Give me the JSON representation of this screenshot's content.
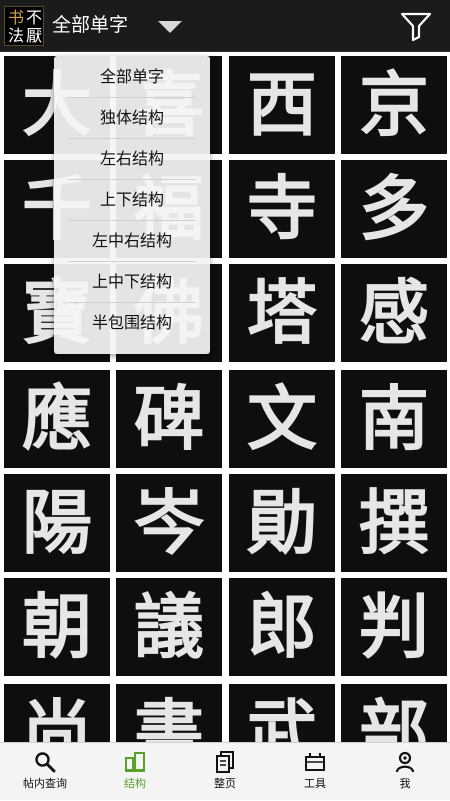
{
  "header": {
    "logo_chars": [
      "书",
      "不",
      "法",
      "厭"
    ],
    "title": "全部单字"
  },
  "characters": [
    "大",
    "喜",
    "西",
    "京",
    "千",
    "福",
    "寺",
    "多",
    "寶",
    "佛",
    "塔",
    "感",
    "應",
    "碑",
    "文",
    "南",
    "陽",
    "岑",
    "勛",
    "撰",
    "朝",
    "議",
    "郎",
    "判",
    "尚",
    "書",
    "武",
    "部"
  ],
  "menu": {
    "items": [
      "全部单字",
      "独体结构",
      "左右结构",
      "上下结构",
      "左中右结构",
      "上中下结构",
      "半包围结构"
    ]
  },
  "bottom_nav": {
    "items": [
      {
        "label": "帖内查询",
        "icon": "search-icon"
      },
      {
        "label": "结构",
        "icon": "structure-icon"
      },
      {
        "label": "整页",
        "icon": "page-icon"
      },
      {
        "label": "工具",
        "icon": "toolbox-icon"
      },
      {
        "label": "我",
        "icon": "user-icon"
      }
    ],
    "active_index": 1
  },
  "colors": {
    "accent": "#5aa02c",
    "topbar_bg": "#1b1b1b",
    "cell_bg": "#0e0e0e"
  }
}
